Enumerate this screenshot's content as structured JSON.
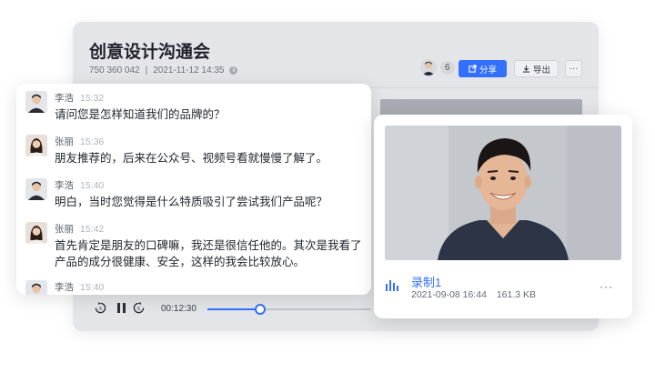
{
  "meeting": {
    "title": "创意设计沟通会",
    "meeting_id": "750 360 042",
    "datetime": "2021-11-12 14:35",
    "info_icon": "i",
    "participant_count": "6",
    "share_label": "分享",
    "export_label": "导出",
    "more_label": "···"
  },
  "player": {
    "current_time": "00:12:30",
    "progress_percent": 32
  },
  "chat": {
    "messages": [
      {
        "name": "李浩",
        "time": "15:32",
        "text": "请问您是怎样知道我们的品牌的？",
        "avatar": "male"
      },
      {
        "name": "张丽",
        "time": "15:36",
        "text": "朋友推荐的，后来在公众号、视频号看就慢慢了解了。",
        "avatar": "female"
      },
      {
        "name": "李浩",
        "time": "15:40",
        "text": "明白，当时您觉得是什么特质吸引了尝试我们产品呢？",
        "avatar": "male"
      },
      {
        "name": "张丽",
        "time": "15:42",
        "text": "首先肯定是朋友的口碑嘛，我还是很信任他的。其次是我看了产品的成分很健康、安全，这样的我会比较放心。",
        "avatar": "female"
      },
      {
        "name": "李浩",
        "time": "15:40",
        "text": "",
        "avatar": "male"
      }
    ]
  },
  "recording": {
    "name": "录制1",
    "date": "2021-09-08 16:44",
    "size": "161.3 KB",
    "more_label": "···"
  },
  "colors": {
    "accent": "#3370ff"
  }
}
